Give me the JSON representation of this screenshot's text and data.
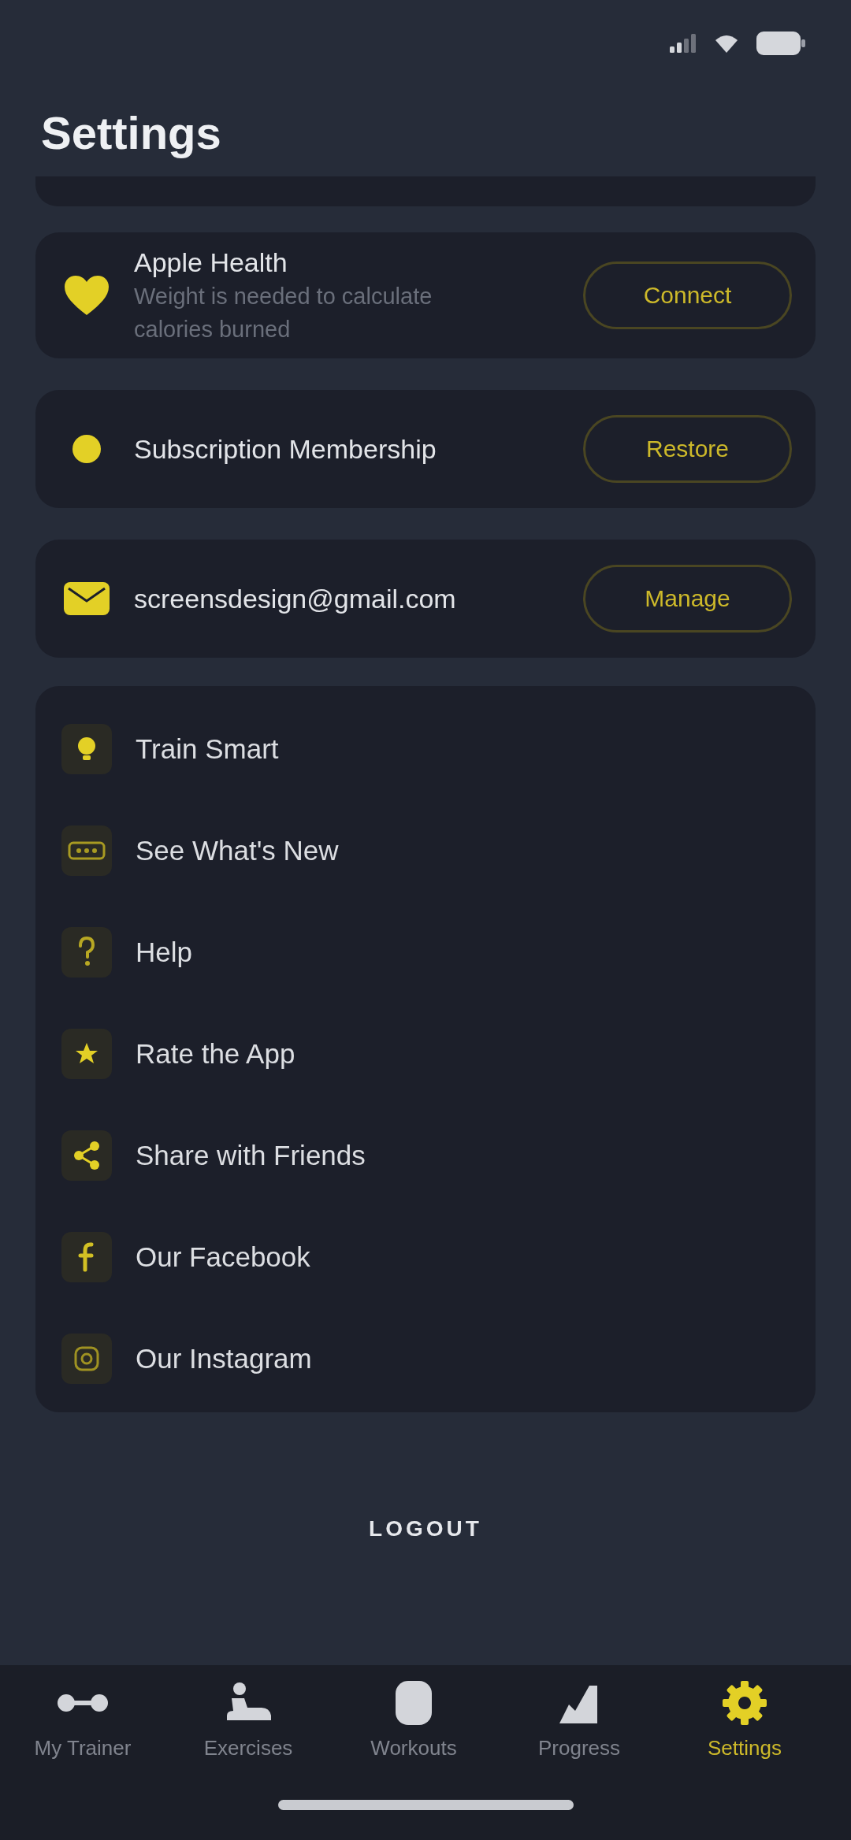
{
  "screen": {
    "title": "Settings"
  },
  "cards": [
    {
      "title": "Apple Health",
      "subtitle": "Weight is needed to calculate calories burned",
      "button": "Connect"
    },
    {
      "title": "Subscription Membership",
      "button": "Restore"
    },
    {
      "title": "screensdesign@gmail.com",
      "button": "Manage"
    }
  ],
  "menu": [
    "Train Smart",
    "See What's New",
    "Help",
    "Rate the App",
    "Share with Friends",
    "Our Facebook",
    "Our Instagram"
  ],
  "logout": "LOGOUT",
  "tab_bar": [
    {
      "label": "My Trainer",
      "selected": false
    },
    {
      "label": "Exercises",
      "selected": false
    },
    {
      "label": "Workouts",
      "selected": false
    },
    {
      "label": "Progress",
      "selected": false
    },
    {
      "label": "Settings",
      "selected": true
    }
  ]
}
